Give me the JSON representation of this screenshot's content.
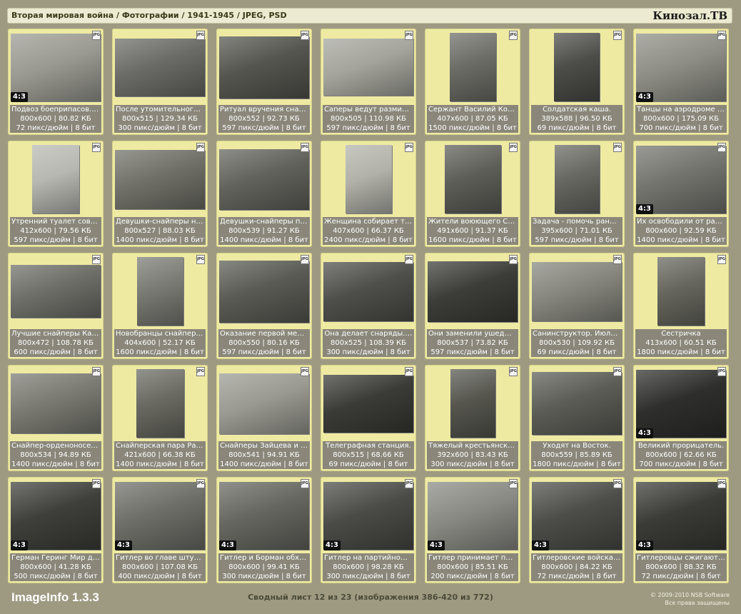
{
  "header": {
    "path": "Вторая мировая война / Фотографии / 1941-1945 / JPEG, PSD",
    "site": "Кинозал.ТВ"
  },
  "tiles": [
    {
      "title": "Подвоз боеприпасов. …",
      "dims": "800x600 | 80.82 КБ",
      "res": "72 пикс/дюйм | 8 бит",
      "ratio": "4:3",
      "w": 800,
      "h": 600,
      "tone": "#9a9a92"
    },
    {
      "title": "После утомительного …",
      "dims": "800x515 | 129.34 КБ",
      "res": "300 пикс/дюйм | 8 бит",
      "ratio": "",
      "w": 800,
      "h": 515,
      "tone": "#6a6a66"
    },
    {
      "title": "Ритуал вручения снай…",
      "dims": "800x552 | 92.73 КБ",
      "res": "597 пикс/дюйм | 8 бит",
      "ratio": "",
      "w": 800,
      "h": 552,
      "tone": "#55554f"
    },
    {
      "title": "Саперы ведут размин…",
      "dims": "800x505 | 110.98 КБ",
      "res": "597 пикс/дюйм | 8 бит",
      "ratio": "",
      "w": 800,
      "h": 505,
      "tone": "#a4a49c"
    },
    {
      "title": "Сержант Василий Кор…",
      "dims": "407x600 | 87.05 КБ",
      "res": "1500 пикс/дюйм | 8 бит",
      "ratio": "",
      "w": 407,
      "h": 600,
      "tone": "#6c6c66"
    },
    {
      "title": "Солдатская каша.",
      "dims": "389x588 | 96.50 КБ",
      "res": "69 пикс/дюйм | 8 бит",
      "ratio": "",
      "w": 389,
      "h": 588,
      "tone": "#4c4c48"
    },
    {
      "title": "Танцы на аэродроме в…",
      "dims": "800x600 | 175.09 КБ",
      "res": "700 пикс/дюйм | 8 бит",
      "ratio": "4:3",
      "w": 800,
      "h": 600,
      "tone": "#8e8e86"
    },
    {
      "title": "Утренний туалет сове…",
      "dims": "412x600 | 79.56 КБ",
      "res": "597 пикс/дюйм | 8 бит",
      "ratio": "",
      "w": 412,
      "h": 600,
      "tone": "#b8b8b2"
    },
    {
      "title": "Девушки-снайперы на…",
      "dims": "800x527 | 88.03 КБ",
      "res": "1400 пикс/дюйм | 8 бит",
      "ratio": "",
      "w": 800,
      "h": 527,
      "tone": "#707068"
    },
    {
      "title": "Девушки-снайперы пе…",
      "dims": "800x539 | 91.27 КБ",
      "res": "1400 пикс/дюйм | 8 бит",
      "ratio": "",
      "w": 800,
      "h": 539,
      "tone": "#62625c"
    },
    {
      "title": "Женщина собирает тр…",
      "dims": "407x600 | 66.37 КБ",
      "res": "2400 пикс/дюйм | 8 бит",
      "ratio": "",
      "w": 407,
      "h": 600,
      "tone": "#b2b2aa"
    },
    {
      "title": "Жители воюющего Ст…",
      "dims": "491x600 | 91.37 КБ",
      "res": "1600 пикс/дюйм | 8 бит",
      "ratio": "",
      "w": 491,
      "h": 600,
      "tone": "#5e5e58"
    },
    {
      "title": "Задача - помочь ране…",
      "dims": "395x600 | 71.01 КБ",
      "res": "597 пикс/дюйм | 8 бит",
      "ratio": "",
      "w": 395,
      "h": 600,
      "tone": "#686862"
    },
    {
      "title": "Их освободили от раб…",
      "dims": "800x600 | 92.59 КБ",
      "res": "1400 пикс/дюйм | 8 бит",
      "ratio": "4:3",
      "w": 800,
      "h": 600,
      "tone": "#74746e"
    },
    {
      "title": "Лучшие снайперы Кал…",
      "dims": "800x472 | 108.78 КБ",
      "res": "600 пикс/дюйм | 8 бит",
      "ratio": "",
      "w": 800,
      "h": 472,
      "tone": "#6e6e68"
    },
    {
      "title": "Новобранцы снайперс…",
      "dims": "404x600 | 52.17 КБ",
      "res": "1600 пикс/дюйм | 8 бит",
      "ratio": "",
      "w": 404,
      "h": 600,
      "tone": "#7a7a74"
    },
    {
      "title": "Оказание первой мед…",
      "dims": "800x550 | 80.16 КБ",
      "res": "597 пикс/дюйм | 8 бит",
      "ratio": "",
      "w": 800,
      "h": 550,
      "tone": "#5a5a54"
    },
    {
      "title": "Она делает снаряды.…",
      "dims": "800x525 | 108.39 КБ",
      "res": "300 пикс/дюйм | 8 бит",
      "ratio": "",
      "w": 800,
      "h": 525,
      "tone": "#4e4e4a"
    },
    {
      "title": "Они заменили ушедши…",
      "dims": "800x537 | 73.82 КБ",
      "res": "597 пикс/дюйм | 8 бит",
      "ratio": "",
      "w": 800,
      "h": 537,
      "tone": "#3c3c38"
    },
    {
      "title": "Санинструктор. Июль…",
      "dims": "800x530 | 109.92 КБ",
      "res": "69 пикс/дюйм | 8 бит",
      "ratio": "",
      "w": 800,
      "h": 530,
      "tone": "#86867e"
    },
    {
      "title": "Сестричка",
      "dims": "413x600 | 60.51 КБ",
      "res": "1800 пикс/дюйм | 8 бит",
      "ratio": "",
      "w": 413,
      "h": 600,
      "tone": "#66665e"
    },
    {
      "title": "Снайпер-орденоносец…",
      "dims": "800x534 | 94.89 КБ",
      "res": "1400 пикс/дюйм | 8 бит",
      "ratio": "",
      "w": 800,
      "h": 534,
      "tone": "#7a7a72"
    },
    {
      "title": "Снайперская пара Раз…",
      "dims": "421x600 | 66.38 КБ",
      "res": "1400 пикс/дюйм | 8 бит",
      "ratio": "",
      "w": 421,
      "h": 600,
      "tone": "#6a6a62"
    },
    {
      "title": "Снайперы Зайцева и П…",
      "dims": "800x541 | 94.91 КБ",
      "res": "1400 пикс/дюйм | 8 бит",
      "ratio": "",
      "w": 800,
      "h": 541,
      "tone": "#9a9a92"
    },
    {
      "title": "Телеграфная станция.",
      "dims": "800x515 | 68.66 КБ",
      "res": "69 пикс/дюйм | 8 бит",
      "ratio": "",
      "w": 800,
      "h": 515,
      "tone": "#3a3a36"
    },
    {
      "title": "Тяжелый крестьянски…",
      "dims": "392x600 | 83.43 КБ",
      "res": "300 пикс/дюйм | 8 бит",
      "ratio": "",
      "w": 392,
      "h": 600,
      "tone": "#56564f"
    },
    {
      "title": "Уходят на Восток.",
      "dims": "800x559 | 85.89 КБ",
      "res": "1800 пикс/дюйм | 8 бит",
      "ratio": "",
      "w": 800,
      "h": 559,
      "tone": "#5c5c56"
    },
    {
      "title": "Великий прорицатель.",
      "dims": "800x600 | 62.66 КБ",
      "res": "700 пикс/дюйм | 8 бит",
      "ratio": "4:3",
      "w": 800,
      "h": 600,
      "tone": "#2e2e2c"
    },
    {
      "title": "Герман Геринг Мир до…",
      "dims": "800x600 | 41.28 КБ",
      "res": "500 пикс/дюйм | 8 бит",
      "ratio": "4:3",
      "w": 800,
      "h": 600,
      "tone": "#3e3e3a"
    },
    {
      "title": "Гитлер во главе штур…",
      "dims": "800x600 | 107.08 КБ",
      "res": "400 пикс/дюйм | 8 бит",
      "ratio": "4:3",
      "w": 800,
      "h": 600,
      "tone": "#6e6e68"
    },
    {
      "title": "Гитлер и Борман обхо…",
      "dims": "800x600 | 99.41 КБ",
      "res": "300 пикс/дюйм | 8 бит",
      "ratio": "4:3",
      "w": 800,
      "h": 600,
      "tone": "#666660"
    },
    {
      "title": "Гитлер на партийном …",
      "dims": "800x600 | 98.28 КБ",
      "res": "300 пикс/дюйм | 8 бит",
      "ratio": "4:3",
      "w": 800,
      "h": 600,
      "tone": "#4a4a46"
    },
    {
      "title": "Гитлер принимает пар…",
      "dims": "800x600 | 85.51 КБ",
      "res": "200 пикс/дюйм | 8 бит",
      "ratio": "4:3",
      "w": 800,
      "h": 600,
      "tone": "#8a8a84"
    },
    {
      "title": "Гитлеровские войска …",
      "dims": "800x600 | 84.22 КБ",
      "res": "72 пикс/дюйм | 8 бит",
      "ratio": "4:3",
      "w": 800,
      "h": 600,
      "tone": "#4c4c48"
    },
    {
      "title": "Гитлеровцы сжигают …",
      "dims": "800x600 | 88.32 КБ",
      "res": "72 пикс/дюйм | 8 бит",
      "ratio": "4:3",
      "w": 800,
      "h": 600,
      "tone": "#3a3a36"
    }
  ],
  "badge": "JPG",
  "footer": {
    "app": "ImageInfo 1.3.3",
    "sheet": "Сводный лист 12 из 23 (изображения 386-420 из 772)",
    "copy_line1": "© 2009-2010 NSB Software",
    "copy_line2": "Все права защищены"
  }
}
